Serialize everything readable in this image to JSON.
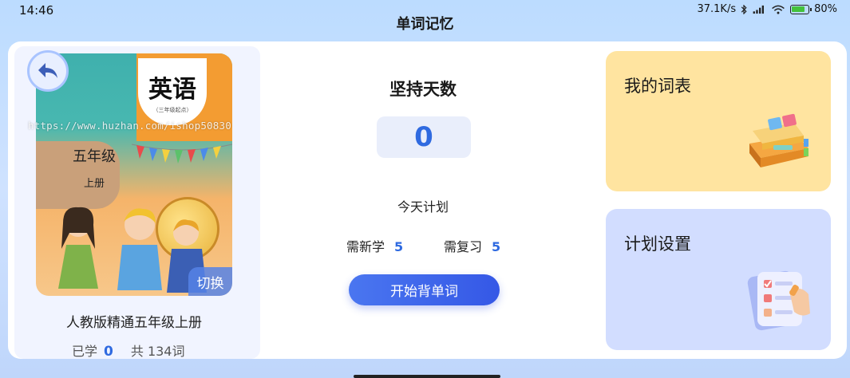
{
  "status_bar": {
    "time": "14:46",
    "net_speed": "37.1K/s",
    "battery": "80%"
  },
  "page_title": "单词记忆",
  "book": {
    "cover_title": "英语",
    "cover_subtitle": "（三年级起点）",
    "cover_grade": "五年级",
    "cover_volume": "上册",
    "switch_label": "切换",
    "name": "人教版精通五年级上册",
    "learned_label": "已学",
    "learned_count": "0",
    "total_label": "共 134词"
  },
  "watermark": "https://www.huzhan.com/ishop50830",
  "streak": {
    "title": "坚持天数",
    "days": "0"
  },
  "today_plan": {
    "title": "今天计划",
    "new_label": "需新学",
    "new_count": "5",
    "review_label": "需复习",
    "review_count": "5",
    "start_button": "开始背单词"
  },
  "cards": {
    "vocab_list": "我的词表",
    "plan_settings": "计划设置"
  },
  "colors": {
    "accent": "#2f6ae0",
    "vocab_card": "#ffe4a0",
    "plan_card": "#d2ddff"
  }
}
